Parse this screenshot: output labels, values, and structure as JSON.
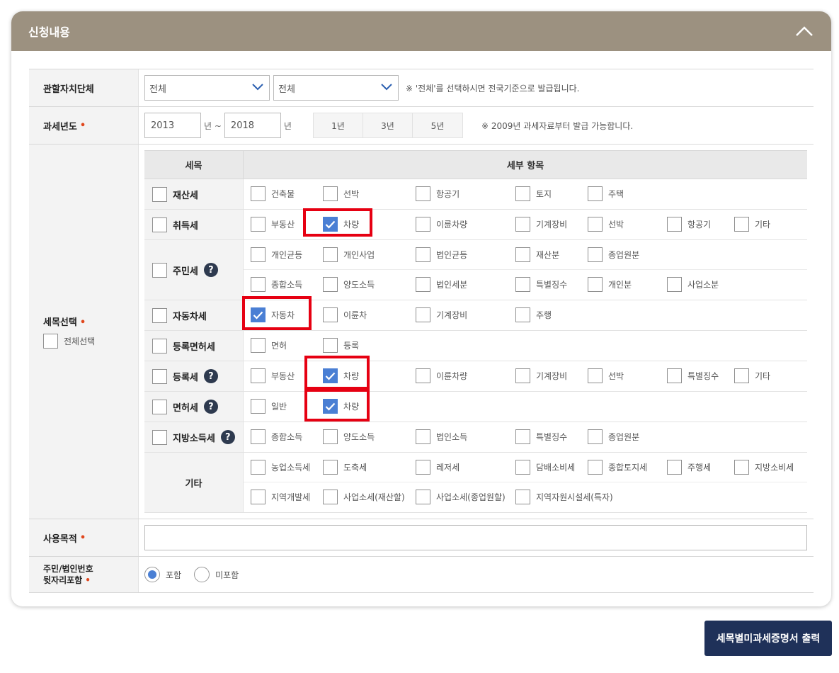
{
  "panel": {
    "title": "신청내용"
  },
  "jurisdiction": {
    "label": "관할자치단체",
    "select1": "전체",
    "select2": "전체",
    "note": "※ '전체'를 선택하시면 전국기준으로 발급됩니다."
  },
  "tax_year": {
    "label": "과세년도",
    "from": "2013",
    "unit1": "년 ~",
    "to": "2018",
    "unit2": "년",
    "periods": [
      "1년",
      "3년",
      "5년"
    ],
    "note": "※ 2009년 과세자료부터 발급 가능합니다."
  },
  "tax_select": {
    "label": "세목선택",
    "select_all": "전체선택",
    "head_tax": "세목",
    "head_detail": "세부 항목",
    "rows": [
      {
        "name": "재산세",
        "has_help": false,
        "lines": [
          [
            "건축물",
            "선박",
            "항공기",
            "토지",
            "주택"
          ]
        ]
      },
      {
        "name": "취득세",
        "has_help": false,
        "lines": [
          [
            "부동산",
            "차량",
            "이륜차량",
            "기계장비",
            "선박",
            "항공기",
            "기타"
          ]
        ]
      },
      {
        "name": "주민세",
        "has_help": true,
        "lines": [
          [
            "개인균등",
            "개인사업",
            "법인균등",
            "재산분",
            "종업원분"
          ],
          [
            "종합소득",
            "양도소득",
            "법인세분",
            "특별징수",
            "개인분",
            "사업소분"
          ]
        ]
      },
      {
        "name": "자동차세",
        "has_help": false,
        "lines": [
          [
            "자동차",
            "이륜차",
            "기계장비",
            "주행"
          ]
        ]
      },
      {
        "name": "등록면허세",
        "has_help": false,
        "lines": [
          [
            "면허",
            "등록"
          ]
        ]
      },
      {
        "name": "등록세",
        "has_help": true,
        "lines": [
          [
            "부동산",
            "차량",
            "이륜차량",
            "기계장비",
            "선박",
            "특별징수",
            "기타"
          ]
        ]
      },
      {
        "name": "면허세",
        "has_help": true,
        "lines": [
          [
            "일반",
            "차량"
          ]
        ]
      },
      {
        "name": "지방소득세",
        "has_help": true,
        "lines": [
          [
            "종합소득",
            "양도소득",
            "법인소득",
            "특별징수",
            "종업원분"
          ]
        ]
      },
      {
        "name": "기타",
        "has_help": false,
        "lines": [
          [
            "농업소득세",
            "도축세",
            "레저세",
            "담배소비세",
            "종합토지세",
            "주행세",
            "지방소비세"
          ],
          [
            "지역개발세",
            "사업소세(재산할)",
            "사업소세(종업원할)",
            "지역자원시설세(특자)"
          ]
        ]
      }
    ],
    "help_glyph": "?"
  },
  "purpose": {
    "label": "사용목적",
    "value": ""
  },
  "idnum": {
    "label_line1": "주민/법인번호",
    "label_line2": "뒷자리포함",
    "opt_include": "포함",
    "opt_exclude": "미포함"
  },
  "print_button": "세목별미과세증명서 출력",
  "colors": {
    "header": "#9c9180",
    "accent": "#4a7fd4",
    "highlight": "#e60012",
    "button": "#1f3159"
  }
}
